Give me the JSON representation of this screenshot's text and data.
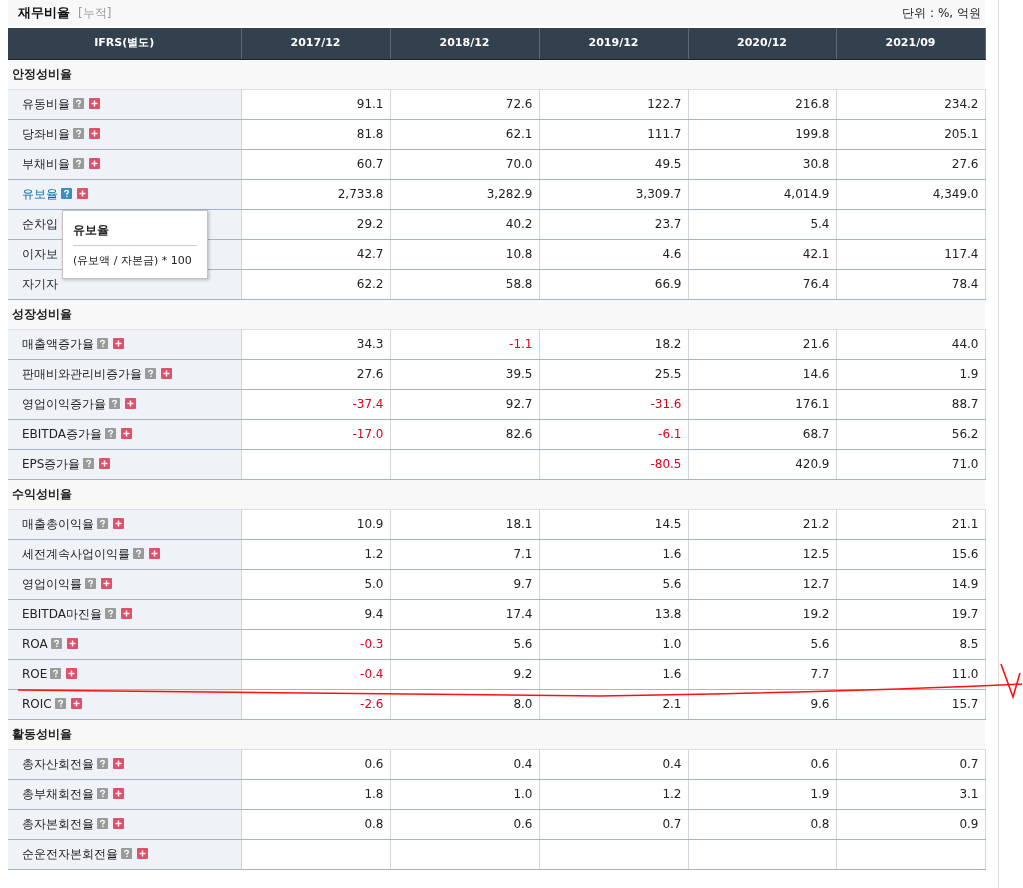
{
  "header": {
    "title": "재무비율",
    "subtitle": "[누적]",
    "unit": "단위 : %, 억원"
  },
  "table": {
    "columns": [
      "IFRS(별도)",
      "2017/12",
      "2018/12",
      "2019/12",
      "2020/12",
      "2021/09"
    ],
    "sections": [
      {
        "title": "안정성비율",
        "rows": [
          {
            "label": "유동비율",
            "buttons": true,
            "active": false,
            "cells": {
              "c1": {
                "text": "91.1",
                "negative": false
              },
              "c2": {
                "text": "72.6",
                "negative": false
              },
              "c3": {
                "text": "122.7",
                "negative": false
              },
              "c4": {
                "text": "216.8",
                "negative": false
              },
              "c5": {
                "text": "234.2",
                "negative": false
              }
            }
          },
          {
            "label": "당좌비율",
            "buttons": true,
            "active": false,
            "cells": {
              "c1": {
                "text": "81.8",
                "negative": false
              },
              "c2": {
                "text": "62.1",
                "negative": false
              },
              "c3": {
                "text": "111.7",
                "negative": false
              },
              "c4": {
                "text": "199.8",
                "negative": false
              },
              "c5": {
                "text": "205.1",
                "negative": false
              }
            }
          },
          {
            "label": "부채비율",
            "buttons": true,
            "active": false,
            "cells": {
              "c1": {
                "text": "60.7",
                "negative": false
              },
              "c2": {
                "text": "70.0",
                "negative": false
              },
              "c3": {
                "text": "49.5",
                "negative": false
              },
              "c4": {
                "text": "30.8",
                "negative": false
              },
              "c5": {
                "text": "27.6",
                "negative": false
              }
            }
          },
          {
            "label": "유보율",
            "buttons": true,
            "active": true,
            "cells": {
              "c1": {
                "text": "2,733.8",
                "negative": false
              },
              "c2": {
                "text": "3,282.9",
                "negative": false
              },
              "c3": {
                "text": "3,309.7",
                "negative": false
              },
              "c4": {
                "text": "4,014.9",
                "negative": false
              },
              "c5": {
                "text": "4,349.0",
                "negative": false
              }
            }
          },
          {
            "label": "순차입",
            "buttons": false,
            "active": false,
            "cells": {
              "c1": {
                "text": "29.2",
                "negative": false
              },
              "c2": {
                "text": "40.2",
                "negative": false
              },
              "c3": {
                "text": "23.7",
                "negative": false
              },
              "c4": {
                "text": "5.4",
                "negative": false
              }
            }
          },
          {
            "label": "이자보",
            "buttons": false,
            "active": false,
            "cells": {
              "c1": {
                "text": "42.7",
                "negative": false
              },
              "c2": {
                "text": "10.8",
                "negative": false
              },
              "c3": {
                "text": "4.6",
                "negative": false
              },
              "c4": {
                "text": "42.1",
                "negative": false
              },
              "c5": {
                "text": "117.4",
                "negative": false
              }
            }
          },
          {
            "label": "자기자",
            "buttons": false,
            "active": false,
            "cells": {
              "c1": {
                "text": "62.2",
                "negative": false
              },
              "c2": {
                "text": "58.8",
                "negative": false
              },
              "c3": {
                "text": "66.9",
                "negative": false
              },
              "c4": {
                "text": "76.4",
                "negative": false
              },
              "c5": {
                "text": "78.4",
                "negative": false
              }
            }
          }
        ]
      },
      {
        "title": "성장성비율",
        "rows": [
          {
            "label": "매출액증가율",
            "buttons": true,
            "active": false,
            "cells": {
              "c1": {
                "text": "34.3",
                "negative": false
              },
              "c2": {
                "text": "-1.1",
                "negative": true
              },
              "c3": {
                "text": "18.2",
                "negative": false
              },
              "c4": {
                "text": "21.6",
                "negative": false
              },
              "c5": {
                "text": "44.0",
                "negative": false
              }
            }
          },
          {
            "label": "판매비와관리비증가율",
            "buttons": true,
            "active": false,
            "cells": {
              "c1": {
                "text": "27.6",
                "negative": false
              },
              "c2": {
                "text": "39.5",
                "negative": false
              },
              "c3": {
                "text": "25.5",
                "negative": false
              },
              "c4": {
                "text": "14.6",
                "negative": false
              },
              "c5": {
                "text": "1.9",
                "negative": false
              }
            }
          },
          {
            "label": "영업이익증가율",
            "buttons": true,
            "active": false,
            "cells": {
              "c1": {
                "text": "-37.4",
                "negative": true
              },
              "c2": {
                "text": "92.7",
                "negative": false
              },
              "c3": {
                "text": "-31.6",
                "negative": true
              },
              "c4": {
                "text": "176.1",
                "negative": false
              },
              "c5": {
                "text": "88.7",
                "negative": false
              }
            }
          },
          {
            "label": "EBITDA증가율",
            "buttons": true,
            "active": false,
            "cells": {
              "c1": {
                "text": "-17.0",
                "negative": true
              },
              "c2": {
                "text": "82.6",
                "negative": false
              },
              "c3": {
                "text": "-6.1",
                "negative": true
              },
              "c4": {
                "text": "68.7",
                "negative": false
              },
              "c5": {
                "text": "56.2",
                "negative": false
              }
            }
          },
          {
            "label": "EPS증가율",
            "buttons": true,
            "active": false,
            "cells": {
              "c3": {
                "text": "-80.5",
                "negative": true
              },
              "c4": {
                "text": "420.9",
                "negative": false
              },
              "c5": {
                "text": "71.0",
                "negative": false
              }
            }
          }
        ]
      },
      {
        "title": "수익성비율",
        "rows": [
          {
            "label": "매출총이익율",
            "buttons": true,
            "active": false,
            "cells": {
              "c1": {
                "text": "10.9",
                "negative": false
              },
              "c2": {
                "text": "18.1",
                "negative": false
              },
              "c3": {
                "text": "14.5",
                "negative": false
              },
              "c4": {
                "text": "21.2",
                "negative": false
              },
              "c5": {
                "text": "21.1",
                "negative": false
              }
            }
          },
          {
            "label": "세전계속사업이익률",
            "buttons": true,
            "active": false,
            "cells": {
              "c1": {
                "text": "1.2",
                "negative": false
              },
              "c2": {
                "text": "7.1",
                "negative": false
              },
              "c3": {
                "text": "1.6",
                "negative": false
              },
              "c4": {
                "text": "12.5",
                "negative": false
              },
              "c5": {
                "text": "15.6",
                "negative": false
              }
            }
          },
          {
            "label": "영업이익률",
            "buttons": true,
            "active": false,
            "cells": {
              "c1": {
                "text": "5.0",
                "negative": false
              },
              "c2": {
                "text": "9.7",
                "negative": false
              },
              "c3": {
                "text": "5.6",
                "negative": false
              },
              "c4": {
                "text": "12.7",
                "negative": false
              },
              "c5": {
                "text": "14.9",
                "negative": false
              }
            }
          },
          {
            "label": "EBITDA마진율",
            "buttons": true,
            "active": false,
            "cells": {
              "c1": {
                "text": "9.4",
                "negative": false
              },
              "c2": {
                "text": "17.4",
                "negative": false
              },
              "c3": {
                "text": "13.8",
                "negative": false
              },
              "c4": {
                "text": "19.2",
                "negative": false
              },
              "c5": {
                "text": "19.7",
                "negative": false
              }
            }
          },
          {
            "label": "ROA",
            "buttons": true,
            "active": false,
            "cells": {
              "c1": {
                "text": "-0.3",
                "negative": true
              },
              "c2": {
                "text": "5.6",
                "negative": false
              },
              "c3": {
                "text": "1.0",
                "negative": false
              },
              "c4": {
                "text": "5.6",
                "negative": false
              },
              "c5": {
                "text": "8.5",
                "negative": false
              }
            }
          },
          {
            "label": "ROE",
            "buttons": true,
            "active": false,
            "cells": {
              "c1": {
                "text": "-0.4",
                "negative": true
              },
              "c2": {
                "text": "9.2",
                "negative": false
              },
              "c3": {
                "text": "1.6",
                "negative": false
              },
              "c4": {
                "text": "7.7",
                "negative": false
              },
              "c5": {
                "text": "11.0",
                "negative": false
              }
            }
          },
          {
            "label": "ROIC",
            "buttons": true,
            "active": false,
            "cells": {
              "c1": {
                "text": "-2.6",
                "negative": true
              },
              "c2": {
                "text": "8.0",
                "negative": false
              },
              "c3": {
                "text": "2.1",
                "negative": false
              },
              "c4": {
                "text": "9.6",
                "negative": false
              },
              "c5": {
                "text": "15.7",
                "negative": false
              }
            }
          }
        ]
      },
      {
        "title": "활동성비율",
        "rows": [
          {
            "label": "총자산회전율",
            "buttons": true,
            "active": false,
            "cells": {
              "c1": {
                "text": "0.6",
                "negative": false
              },
              "c2": {
                "text": "0.4",
                "negative": false
              },
              "c3": {
                "text": "0.4",
                "negative": false
              },
              "c4": {
                "text": "0.6",
                "negative": false
              },
              "c5": {
                "text": "0.7",
                "negative": false
              }
            }
          },
          {
            "label": "총부채회전율",
            "buttons": true,
            "active": false,
            "cells": {
              "c1": {
                "text": "1.8",
                "negative": false
              },
              "c2": {
                "text": "1.0",
                "negative": false
              },
              "c3": {
                "text": "1.2",
                "negative": false
              },
              "c4": {
                "text": "1.9",
                "negative": false
              },
              "c5": {
                "text": "3.1",
                "negative": false
              }
            }
          },
          {
            "label": "총자본회전율",
            "buttons": true,
            "active": false,
            "cells": {
              "c1": {
                "text": "0.8",
                "negative": false
              },
              "c2": {
                "text": "0.6",
                "negative": false
              },
              "c3": {
                "text": "0.7",
                "negative": false
              },
              "c4": {
                "text": "0.8",
                "negative": false
              },
              "c5": {
                "text": "0.9",
                "negative": false
              }
            }
          },
          {
            "label": "순운전자본회전율",
            "buttons": true,
            "active": false
          }
        ]
      }
    ]
  },
  "tooltip": {
    "title": "유보율",
    "formula": "(유보액 / 자본금) * 100"
  }
}
